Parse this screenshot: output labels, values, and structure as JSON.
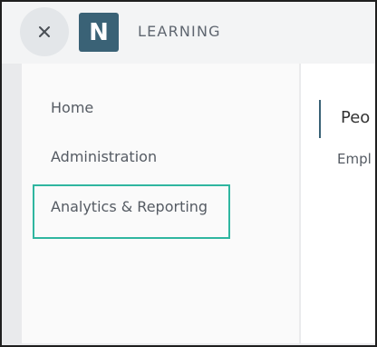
{
  "header": {
    "logo_letter": "N",
    "app_title": "LEARNING",
    "close_icon": "close-icon"
  },
  "menu": {
    "items": [
      {
        "label": "Home"
      },
      {
        "label": "Administration"
      },
      {
        "label": "Analytics & Reporting"
      }
    ],
    "highlighted_item": "Analytics & Reporting",
    "highlight_color": "#2fb6a0"
  },
  "content": {
    "heading": "Peo",
    "subheading": "Empl"
  },
  "colors": {
    "brand": "#3a6276",
    "accent": "#2fb6a0"
  }
}
